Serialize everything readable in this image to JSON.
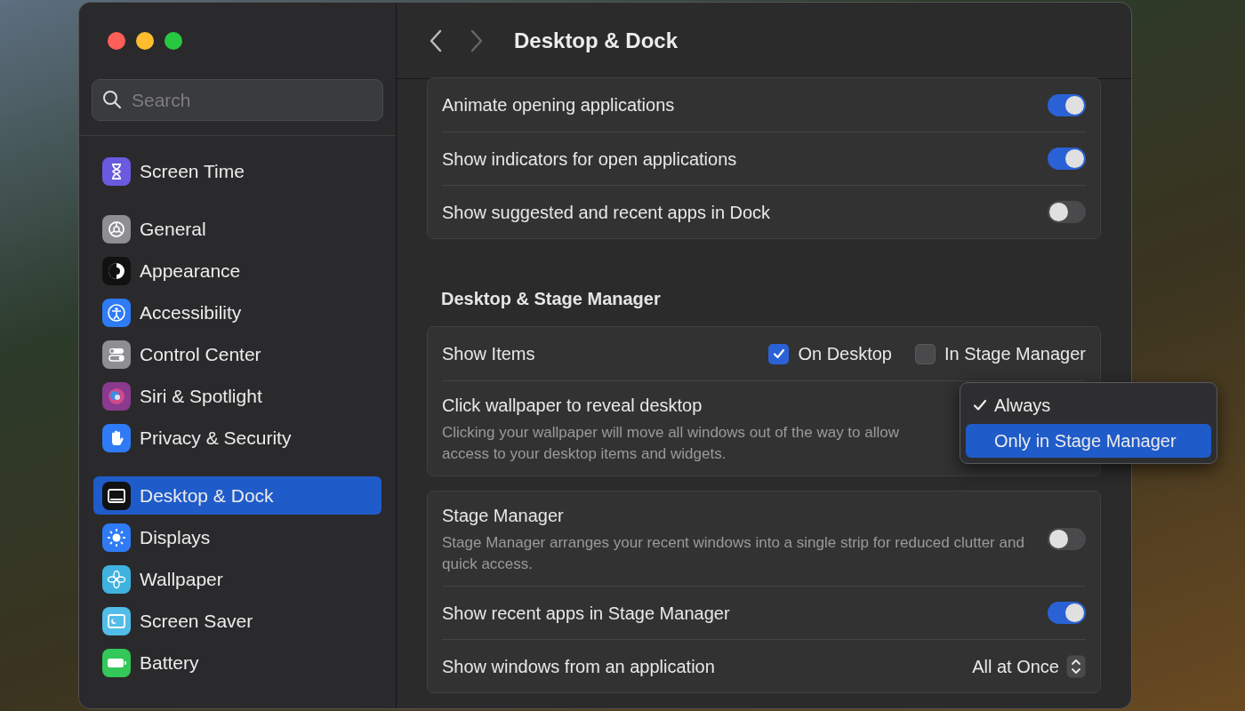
{
  "window": {
    "title": "Desktop & Dock"
  },
  "sidebar": {
    "search": {
      "placeholder": "Search"
    },
    "groups": [
      [
        {
          "label": "Screen Time",
          "color": "#6a5ae0",
          "selected": false
        }
      ],
      [
        {
          "label": "General",
          "color": "#8e8e93",
          "selected": false
        },
        {
          "label": "Appearance",
          "color": "#111111",
          "selected": false
        },
        {
          "label": "Accessibility",
          "color": "#2f7bf5",
          "selected": false
        },
        {
          "label": "Control Center",
          "color": "#8e8e93",
          "selected": false
        },
        {
          "label": "Siri & Spotlight",
          "color": "#8a3a8f",
          "selected": false
        },
        {
          "label": "Privacy & Security",
          "color": "#2f7bf5",
          "selected": false
        }
      ],
      [
        {
          "label": "Desktop & Dock",
          "color": "#111111",
          "selected": true
        },
        {
          "label": "Displays",
          "color": "#2f7bf5",
          "selected": false
        },
        {
          "label": "Wallpaper",
          "color": "#3fb2e0",
          "selected": false
        },
        {
          "label": "Screen Saver",
          "color": "#52bde8",
          "selected": false
        },
        {
          "label": "Battery",
          "color": "#34c759",
          "selected": false
        }
      ]
    ]
  },
  "sections": [
    {
      "rows": [
        {
          "kind": "toggle",
          "label": "Animate opening applications",
          "on": true
        },
        {
          "kind": "toggle",
          "label": "Show indicators for open applications",
          "on": true
        },
        {
          "kind": "toggle",
          "label": "Show suggested and recent apps in Dock",
          "on": false
        }
      ]
    },
    {
      "heading": "Desktop & Stage Manager",
      "rows": [
        {
          "kind": "checkboxes",
          "label": "Show Items",
          "options": [
            {
              "label": "On Desktop",
              "checked": true
            },
            {
              "label": "In Stage Manager",
              "checked": false
            }
          ]
        },
        {
          "kind": "menu",
          "label": "Click wallpaper to reveal desktop",
          "description": "Clicking your wallpaper will move all windows out of the way to allow access to your desktop items and widgets.",
          "menu": [
            {
              "label": "Always",
              "checked": true,
              "highlighted": false
            },
            {
              "label": "Only in Stage Manager",
              "checked": false,
              "highlighted": true
            }
          ]
        }
      ]
    },
    {
      "rows": [
        {
          "kind": "toggle",
          "label": "Stage Manager",
          "description": "Stage Manager arranges your recent windows into a single strip for reduced clutter and quick access.",
          "on": false
        },
        {
          "kind": "toggle",
          "label": "Show recent apps in Stage Manager",
          "on": true
        },
        {
          "kind": "popup",
          "label": "Show windows from an application",
          "value": "All at Once"
        }
      ]
    }
  ]
}
